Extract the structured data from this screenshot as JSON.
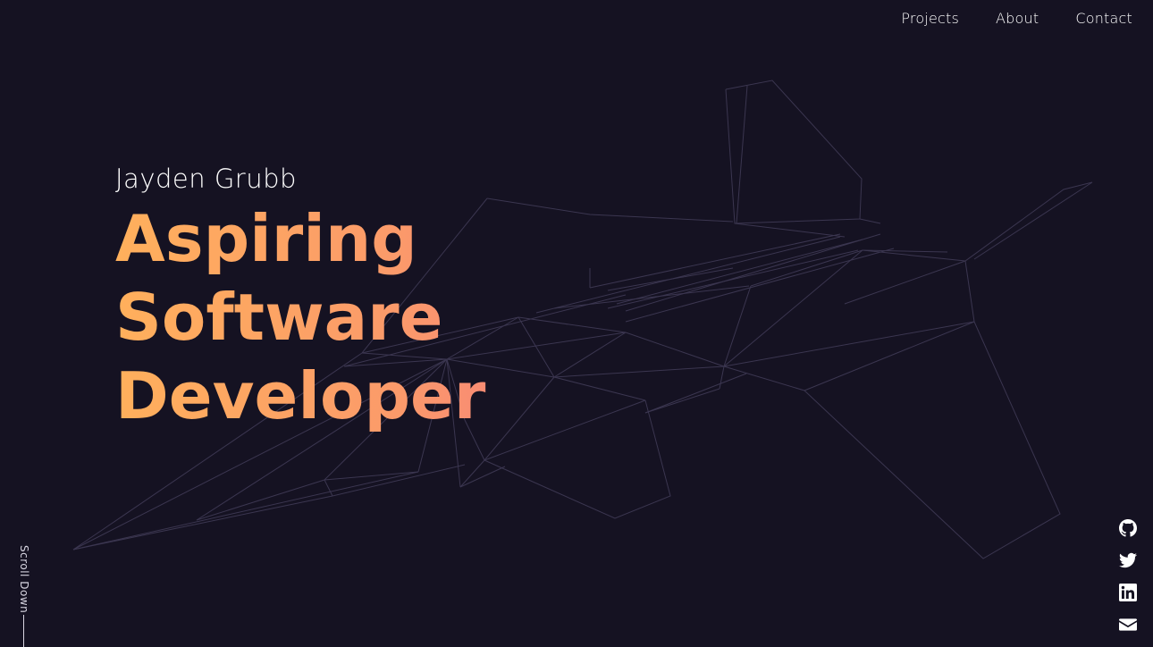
{
  "nav": {
    "items": [
      {
        "label": "Projects"
      },
      {
        "label": "About"
      },
      {
        "label": "Contact"
      }
    ]
  },
  "hero": {
    "name": "Jayden Grubb",
    "headline": "Aspiring Software Developer"
  },
  "scroll": {
    "label": "Scroll Down"
  },
  "social": {
    "icons": [
      "github-icon",
      "twitter-icon",
      "linkedin-icon",
      "mail-icon"
    ]
  },
  "colors": {
    "background": "#151222",
    "gradient_start": "#ffb05c",
    "gradient_end": "#f2658d",
    "wireframe": "#3b3650"
  }
}
